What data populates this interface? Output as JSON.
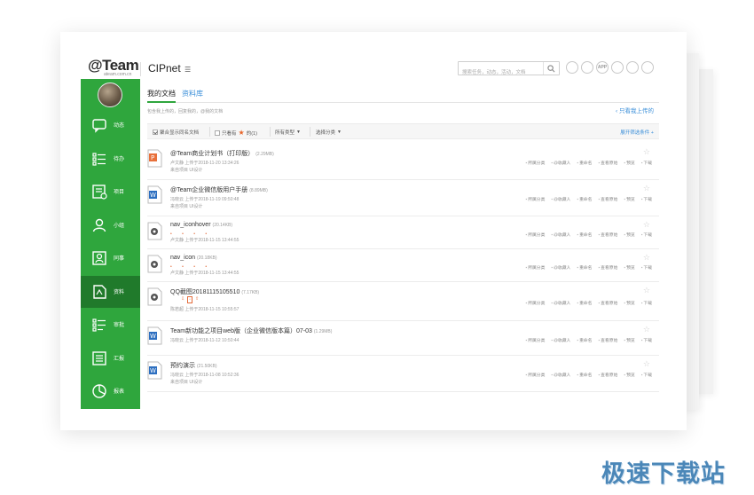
{
  "app": {
    "logo_text": "@Team",
    "logo_sub": "ateam.com.cn",
    "project_name": "CIPnet",
    "project_caret": "☰"
  },
  "search": {
    "placeholder": "搜索任务，动态，活动，文档"
  },
  "top_icons": [
    "ACT-icon",
    "B-icon",
    "APP-icon",
    "mic-icon",
    "mail-icon",
    "gear-icon"
  ],
  "top_icon_labels": [
    "",
    "",
    "APP",
    "",
    "",
    ""
  ],
  "sidebar": {
    "items": [
      {
        "label": "动态",
        "icon": "chat-icon"
      },
      {
        "label": "待办",
        "icon": "todo-list-icon"
      },
      {
        "label": "项目",
        "icon": "project-icon"
      },
      {
        "label": "小组",
        "icon": "group-icon"
      },
      {
        "label": "同事",
        "icon": "colleague-icon"
      },
      {
        "label": "资料",
        "icon": "document-icon",
        "active": true
      },
      {
        "label": "审批",
        "icon": "approval-icon"
      },
      {
        "label": "汇报",
        "icon": "report-icon"
      },
      {
        "label": "报表",
        "icon": "chart-icon"
      }
    ]
  },
  "tabs": {
    "mine": "我的文档",
    "library": "资料库"
  },
  "subtitle": "包含我上传的，回复我的，@我的文档",
  "mine_link": "只看我上传的",
  "filters": {
    "merge_same_name": "聚合显示同名文档",
    "only_view": "只看有",
    "only_view_suffix": "的(1)",
    "all_types": "所有类型",
    "select_category": "选择分类",
    "expand": "展开筛选条件"
  },
  "accent_colors": {
    "sidebar": "#2fa63d",
    "sidebar_active": "#207a2b",
    "link": "#3b8fd9",
    "star": "#e8652a"
  },
  "files": [
    {
      "title": "@Team商业计划书（打印版）",
      "size": "(2.29MB)",
      "type": "ppt",
      "meta": "卢文静  上传于2018-11-20 13:34:26",
      "project": "来自项目 UI设计",
      "actions": [
        "所属分类",
        "@收藏人",
        "重命名",
        "查看原始",
        "预览",
        "下载"
      ]
    },
    {
      "title": "@Team企业微信版用户手册",
      "size": "(8.89MB)",
      "type": "word",
      "meta": "冯晓云  上传于2018-11-19 09:50:48",
      "project": "来自项目 UI设计",
      "actions": [
        "所属分类",
        "@收藏人",
        "重命名",
        "查看原始",
        "预览",
        "下载"
      ]
    },
    {
      "title": "nav_iconhover",
      "size": "(20.14KB)",
      "type": "file",
      "meta": "卢文静  上传于2018-11-15 13:44:55",
      "project": "",
      "actions": [
        "所属分类",
        "@收藏人",
        "重命名",
        "查看原始",
        "预览",
        "下载"
      ]
    },
    {
      "title": "nav_icon",
      "size": "(20.18KB)",
      "type": "file",
      "meta": "卢文静  上传于2018-11-15 13:44:55",
      "project": "",
      "actions": [
        "所属分类",
        "@收藏人",
        "重命名",
        "查看原始",
        "预览",
        "下载"
      ]
    },
    {
      "title": "QQ截图20181115105510",
      "size": "(7.17KB)",
      "type": "file",
      "meta": "陈若超  上传于2018-11-15 10:55:57",
      "project": "",
      "actions": [
        "所属分类",
        "@收藏人",
        "重命名",
        "查看原始",
        "预览",
        "下载"
      ]
    },
    {
      "title": "Team新功能之项目web版（企业微信版本篇）07-03",
      "size": "(1.29MB)",
      "type": "word",
      "meta": "冯晓云  上传于2018-11-12 10:50:44",
      "project": "",
      "actions": [
        "所属分类",
        "@收藏人",
        "重命名",
        "查看原始",
        "预览",
        "下载"
      ]
    },
    {
      "title": "预约演示",
      "size": "(21.50KB)",
      "type": "word",
      "meta": "冯晓云  上传于2018-11-08 10:52:36",
      "project": "来自项目 UI设计",
      "actions": [
        "所属分类",
        "@收藏人",
        "重命名",
        "查看原始",
        "预览",
        "下载"
      ]
    }
  ],
  "watermark": "极速下载站"
}
